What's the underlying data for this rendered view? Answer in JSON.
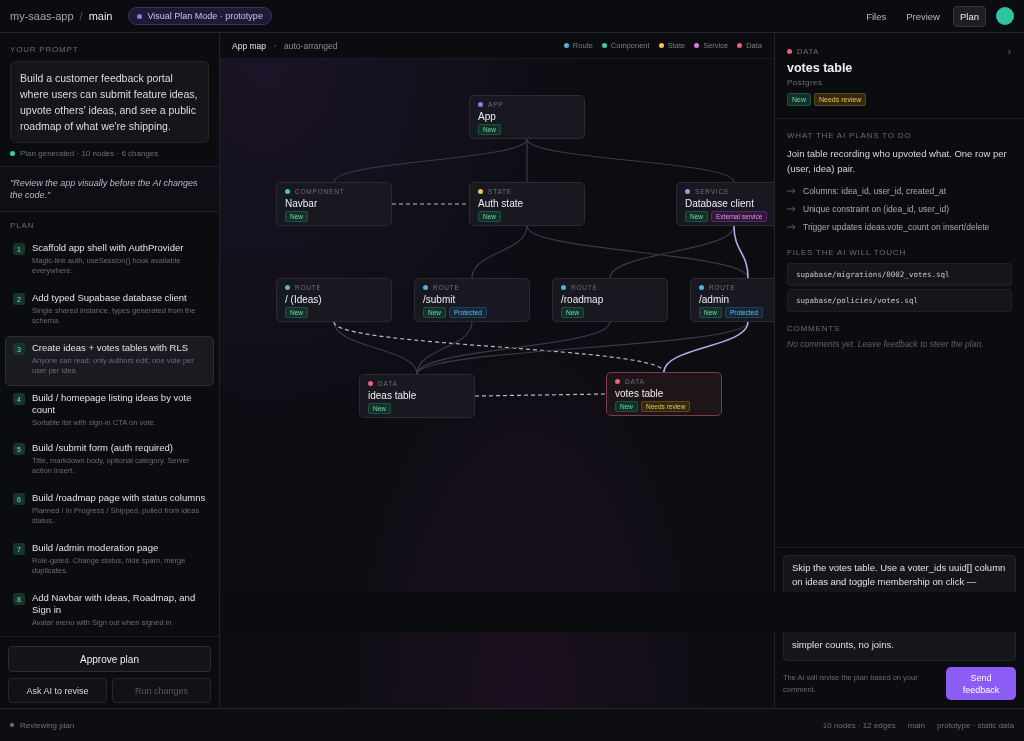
{
  "topbar": {
    "project": "my-saas-app",
    "separator": "/",
    "branch": "main",
    "mode_pill": "Visual Plan Mode · prototype",
    "nav": [
      {
        "label": "Files",
        "selected": false
      },
      {
        "label": "Preview",
        "selected": false
      },
      {
        "label": "Plan",
        "selected": true
      }
    ]
  },
  "prompt_panel": {
    "heading": "YOUR PROMPT",
    "prompt": "Build a customer feedback portal where users can submit feature ideas, upvote others' ideas, and see a public roadmap of what we're shipping.",
    "status": "Plan generated · 10 nodes · 6 changes",
    "quote": "\"Review the app visually before the AI changes the code.\"",
    "plan_heading": "PLAN"
  },
  "plan": [
    {
      "number": "1",
      "title": "Scaffold app shell with AuthProvider",
      "detail": "Magic-link auth, useSession() hook available everywhere.",
      "selected": false
    },
    {
      "number": "2",
      "title": "Add typed Supabase database client",
      "detail": "Single shared instance, types generated from the schema.",
      "selected": false
    },
    {
      "number": "3",
      "title": "Create ideas + votes tables with RLS",
      "detail": "Anyone can read; only authors edit; one vote per user per idea.",
      "selected": true
    },
    {
      "number": "4",
      "title": "Build / homepage listing ideas by vote count",
      "detail": "Sortable list with sign-in CTA on vote.",
      "selected": false
    },
    {
      "number": "5",
      "title": "Build /submit form (auth required)",
      "detail": "Title, markdown body, optional category. Server action insert.",
      "selected": false
    },
    {
      "number": "6",
      "title": "Build /roadmap page with status columns",
      "detail": "Planned / In Progress / Shipped, pulled from ideas status.",
      "selected": false
    },
    {
      "number": "7",
      "title": "Build /admin moderation page",
      "detail": "Role-gated. Change status, hide spam, merge duplicates.",
      "selected": false
    },
    {
      "number": "8",
      "title": "Add Navbar with Ideas, Roadmap, and Sign in",
      "detail": "Avatar menu with Sign out when signed in.",
      "selected": false
    }
  ],
  "actions": [
    {
      "label": "Approve plan",
      "kind": "primary",
      "disabled": false
    },
    {
      "label": "Ask AI to revise",
      "kind": "secondary",
      "disabled": false
    },
    {
      "label": "Run changes",
      "kind": "secondary",
      "disabled": true
    }
  ],
  "map": {
    "title": "App map",
    "subtitle": "auto-arranged",
    "legend": [
      {
        "label": "Route",
        "color": "#4fb3e8"
      },
      {
        "label": "Component",
        "color": "#3ecf9e"
      },
      {
        "label": "State",
        "color": "#f2c14e"
      },
      {
        "label": "Service",
        "color": "#d67ce8"
      },
      {
        "label": "Data",
        "color": "#f0607a"
      }
    ],
    "nodes": [
      {
        "category": "APP",
        "title": "App",
        "color": "#8b7cf6",
        "selected": false,
        "badges": [
          {
            "label": "New",
            "kind": "new"
          }
        ]
      },
      {
        "category": "COMPONENT",
        "title": "Navbar",
        "color": "#3ecf9e",
        "selected": false,
        "badges": [
          {
            "label": "New",
            "kind": "new"
          }
        ]
      },
      {
        "category": "STATE",
        "title": "Auth state",
        "color": "#f2c14e",
        "selected": false,
        "badges": [
          {
            "label": "New",
            "kind": "new"
          }
        ]
      },
      {
        "category": "SERVICE",
        "title": "Database client",
        "color": "#d67ce8",
        "selected": false,
        "badges": [
          {
            "label": "New",
            "kind": "new"
          },
          {
            "label": "External service",
            "kind": "external"
          }
        ]
      },
      {
        "category": "ROUTE",
        "title": "/ (Ideas)",
        "color": "#4fb3e8",
        "selected": false,
        "badges": [
          {
            "label": "New",
            "kind": "new"
          }
        ]
      },
      {
        "category": "ROUTE",
        "title": "/submit",
        "color": "#4fb3e8",
        "selected": false,
        "badges": [
          {
            "label": "New",
            "kind": "new"
          },
          {
            "label": "Protected",
            "kind": "protected"
          }
        ]
      },
      {
        "category": "ROUTE",
        "title": "/roadmap",
        "color": "#4fb3e8",
        "selected": false,
        "badges": [
          {
            "label": "New",
            "kind": "new"
          }
        ]
      },
      {
        "category": "ROUTE",
        "title": "/admin",
        "color": "#4fb3e8",
        "selected": false,
        "badges": [
          {
            "label": "New",
            "kind": "new"
          },
          {
            "label": "Protected",
            "kind": "protected"
          }
        ]
      },
      {
        "category": "DATA",
        "title": "ideas table",
        "color": "#f0607a",
        "selected": false,
        "badges": [
          {
            "label": "New",
            "kind": "new"
          }
        ]
      },
      {
        "category": "DATA",
        "title": "votes table",
        "color": "#f0607a",
        "selected": true,
        "badges": [
          {
            "label": "New",
            "kind": "new"
          },
          {
            "label": "Needs review",
            "kind": "review"
          }
        ]
      }
    ]
  },
  "detail": {
    "category": "DATA",
    "color": "#f0607a",
    "title": "votes table",
    "subtitle": "Postgres",
    "badges": [
      {
        "label": "New",
        "kind": "new"
      },
      {
        "label": "Needs review",
        "kind": "review"
      }
    ],
    "collapse": "›",
    "plan_heading": "WHAT THE AI PLANS TO DO",
    "description": "Join table recording who upvoted what. One row per (user, idea) pair.",
    "steps": [
      "Columns: idea_id, user_id, created_at",
      "Unique constraint on (idea_id, user_id)",
      "Trigger updates ideas.vote_count on insert/delete"
    ],
    "files_heading": "FILES THE AI WILL TOUCH",
    "files": [
      "supabase/migrations/0002_votes.sql",
      "supabase/policies/votes.sql"
    ],
    "comments_heading": "COMMENTS",
    "comments_empty": "No comments yet. Leave feedback to steer the plan.",
    "comment_lines_top": [
      "Skip the votes table. Use a voter_ids uuid[] column",
      "on ideas and toggle membership on click —"
    ],
    "comment_lines_bottom": [
      "simpler counts, no joins."
    ],
    "hint": "The AI will revise the plan based on your comment.",
    "send": "Send feedback"
  },
  "status_bar": {
    "state": "Reviewing plan",
    "stats": [
      "10 nodes · 12 edges",
      "main",
      "prototype · static data"
    ]
  }
}
